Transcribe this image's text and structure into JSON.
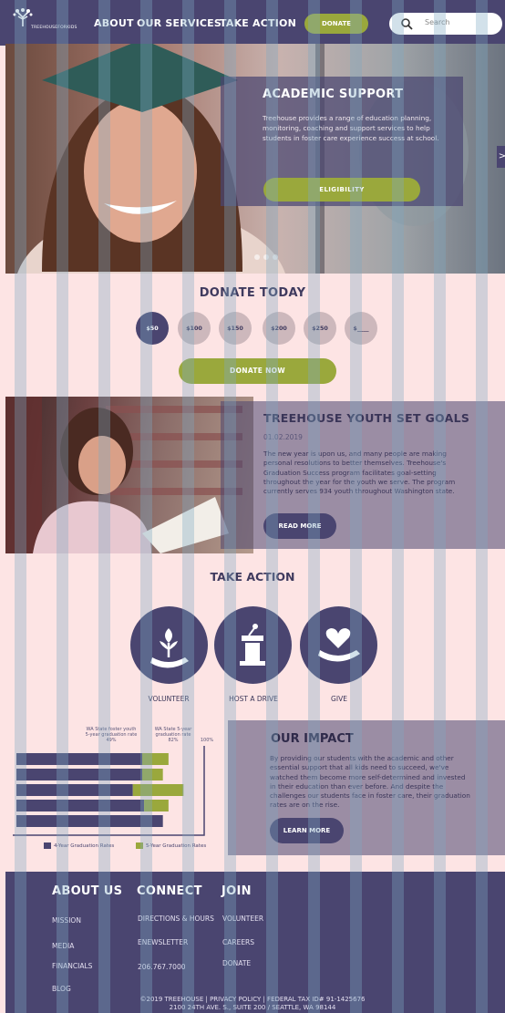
{
  "header": {
    "logo_text": "TREEHOUSEFORKIDS",
    "nav": [
      "ABOUT",
      "OUR SERVICES",
      "TAKE ACTION"
    ],
    "donate_label": "DONATE",
    "search_placeholder": "Search"
  },
  "hero": {
    "title": "ACADEMIC SUPPORT",
    "text": "Treehouse provides a range of education planning, monitoring, coaching and support services to help students in foster care experience success at school.",
    "button": "ELIGIBILITY",
    "arrow": ">"
  },
  "donate": {
    "title": "DONATE TODAY",
    "amounts": [
      "$50",
      "$100",
      "$150",
      "$200",
      "$250",
      "$____"
    ],
    "button": "DONATE NOW"
  },
  "goals": {
    "title": "TREEHOUSE YOUTH SET GOALS",
    "date": "01.02.2019",
    "text": "The new year is upon us, and many people are making personal resolutions to better themselves. Treehouse's Graduation Success program facilitates goal-setting throughout the year for the youth we serve. The program currently serves 934 youth throughout Washington state.",
    "button": "READ MORE"
  },
  "take_action": {
    "title": "TAKE ACTION",
    "items": [
      "VOLUNTEER",
      "HOST A DRIVE",
      "GIVE"
    ]
  },
  "impact": {
    "title": "OUR IMPACT",
    "text": "By providing our students with the academic and other essential support that all kids need to succeed, we've watched them become more self-determined and invested in their education than ever before. And despite the challenges our students face in foster care, their graduation rates are on the rise.",
    "button": "LEARN MORE"
  },
  "chart_data": {
    "type": "bar",
    "orientation": "horizontal",
    "annotations": [
      {
        "label": "WA State foster youth 5-year graduation rate",
        "value": "49%"
      },
      {
        "label": "WA State 5-year graduation rate",
        "value": "82%"
      },
      {
        "label": "",
        "value": "100%"
      }
    ],
    "series": [
      {
        "name": "4-Year Graduation Rates",
        "color": "#4a4570",
        "values": [
          67,
          67,
          62,
          68,
          78
        ]
      },
      {
        "name": "5-Year Graduation Rates",
        "color": "#9aa83c",
        "values": [
          14,
          11,
          27,
          13,
          0
        ]
      }
    ],
    "xlim": [
      0,
      100
    ]
  },
  "footer": {
    "about_title": "ABOUT US",
    "about_links": [
      "MISSION",
      "MEDIA",
      "FINANCIALS",
      "BLOG"
    ],
    "connect_title": "CONNECT",
    "connect_links": [
      "DIRECTIONS & HOURS",
      "ENEWSLETTER",
      "206.767.7000"
    ],
    "join_title": "JOIN",
    "join_links": [
      "VOLUNTEER",
      "CAREERS",
      "DONATE"
    ],
    "copyright_line1": "©2019 TREEHOUSE | PRIVACY POLICY | FEDERAL TAX ID# 91-1425676",
    "copyright_line2": "2100 24TH AVE. S., SUITE 200 / SEATTLE, WA 98144"
  },
  "colors": {
    "primary": "#4a4570",
    "accent": "#9aa83c",
    "background": "#fde4e4",
    "grid_stripe": "#7fa8c4"
  }
}
